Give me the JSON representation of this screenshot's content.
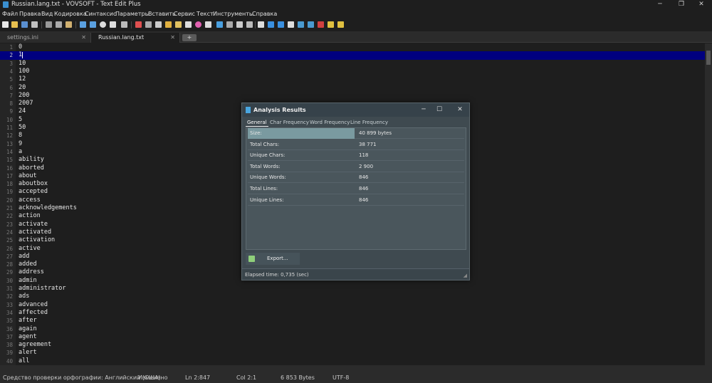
{
  "window": {
    "title": "Russian.lang.txt - VOVSOFT - Text Edit Plus",
    "minimize": "─",
    "maximize": "❐",
    "close": "✕"
  },
  "menu": [
    "Файл",
    "Правка",
    "Вид",
    "Кодировка",
    "Синтаксис",
    "Параметры",
    "Вставить",
    "Сервис",
    "Текст",
    "Инструменты",
    "Справка"
  ],
  "tabs": [
    {
      "label": "settings.ini",
      "close": "✕"
    },
    {
      "label": "Russian.lang.txt",
      "close": "✕"
    }
  ],
  "tab_add": "+",
  "editor": {
    "lines": [
      "0",
      "1",
      "10",
      "100",
      "12",
      "20",
      "200",
      "2007",
      "24",
      "5",
      "50",
      "8",
      "9",
      "a",
      "ability",
      "aborted",
      "about",
      "aboutbox",
      "accepted",
      "access",
      "acknowledgements",
      "action",
      "activate",
      "activated",
      "activation",
      "active",
      "add",
      "added",
      "address",
      "admin",
      "administrator",
      "ads",
      "advanced",
      "affected",
      "after",
      "again",
      "agent",
      "agreement",
      "alert",
      "all"
    ],
    "current_line": 2
  },
  "statusbar": {
    "spell": "Средство проверки орфографии: Английский (США)",
    "modified": "Изменено",
    "line": "Ln 2:847",
    "col": "Col 2:1",
    "size": "6 853 Bytes",
    "encoding": "UTF-8"
  },
  "dialog": {
    "title": "Analysis Results",
    "tabs": [
      "General",
      "Char Frequency",
      "Word Frequency",
      "Line Frequency"
    ],
    "active_tab": "General",
    "rows": [
      {
        "key": "Size:",
        "value": "40 899 bytes"
      },
      {
        "key": "Total Chars:",
        "value": "38 771"
      },
      {
        "key": "Unique Chars:",
        "value": "118"
      },
      {
        "key": "Total Words:",
        "value": "2 900"
      },
      {
        "key": "Unique Words:",
        "value": "846"
      },
      {
        "key": "Total Lines:",
        "value": "846"
      },
      {
        "key": "Unique Lines:",
        "value": "846"
      }
    ],
    "export_label": "Export...",
    "elapsed": "Elapsed time: 0,735 (sec)"
  }
}
